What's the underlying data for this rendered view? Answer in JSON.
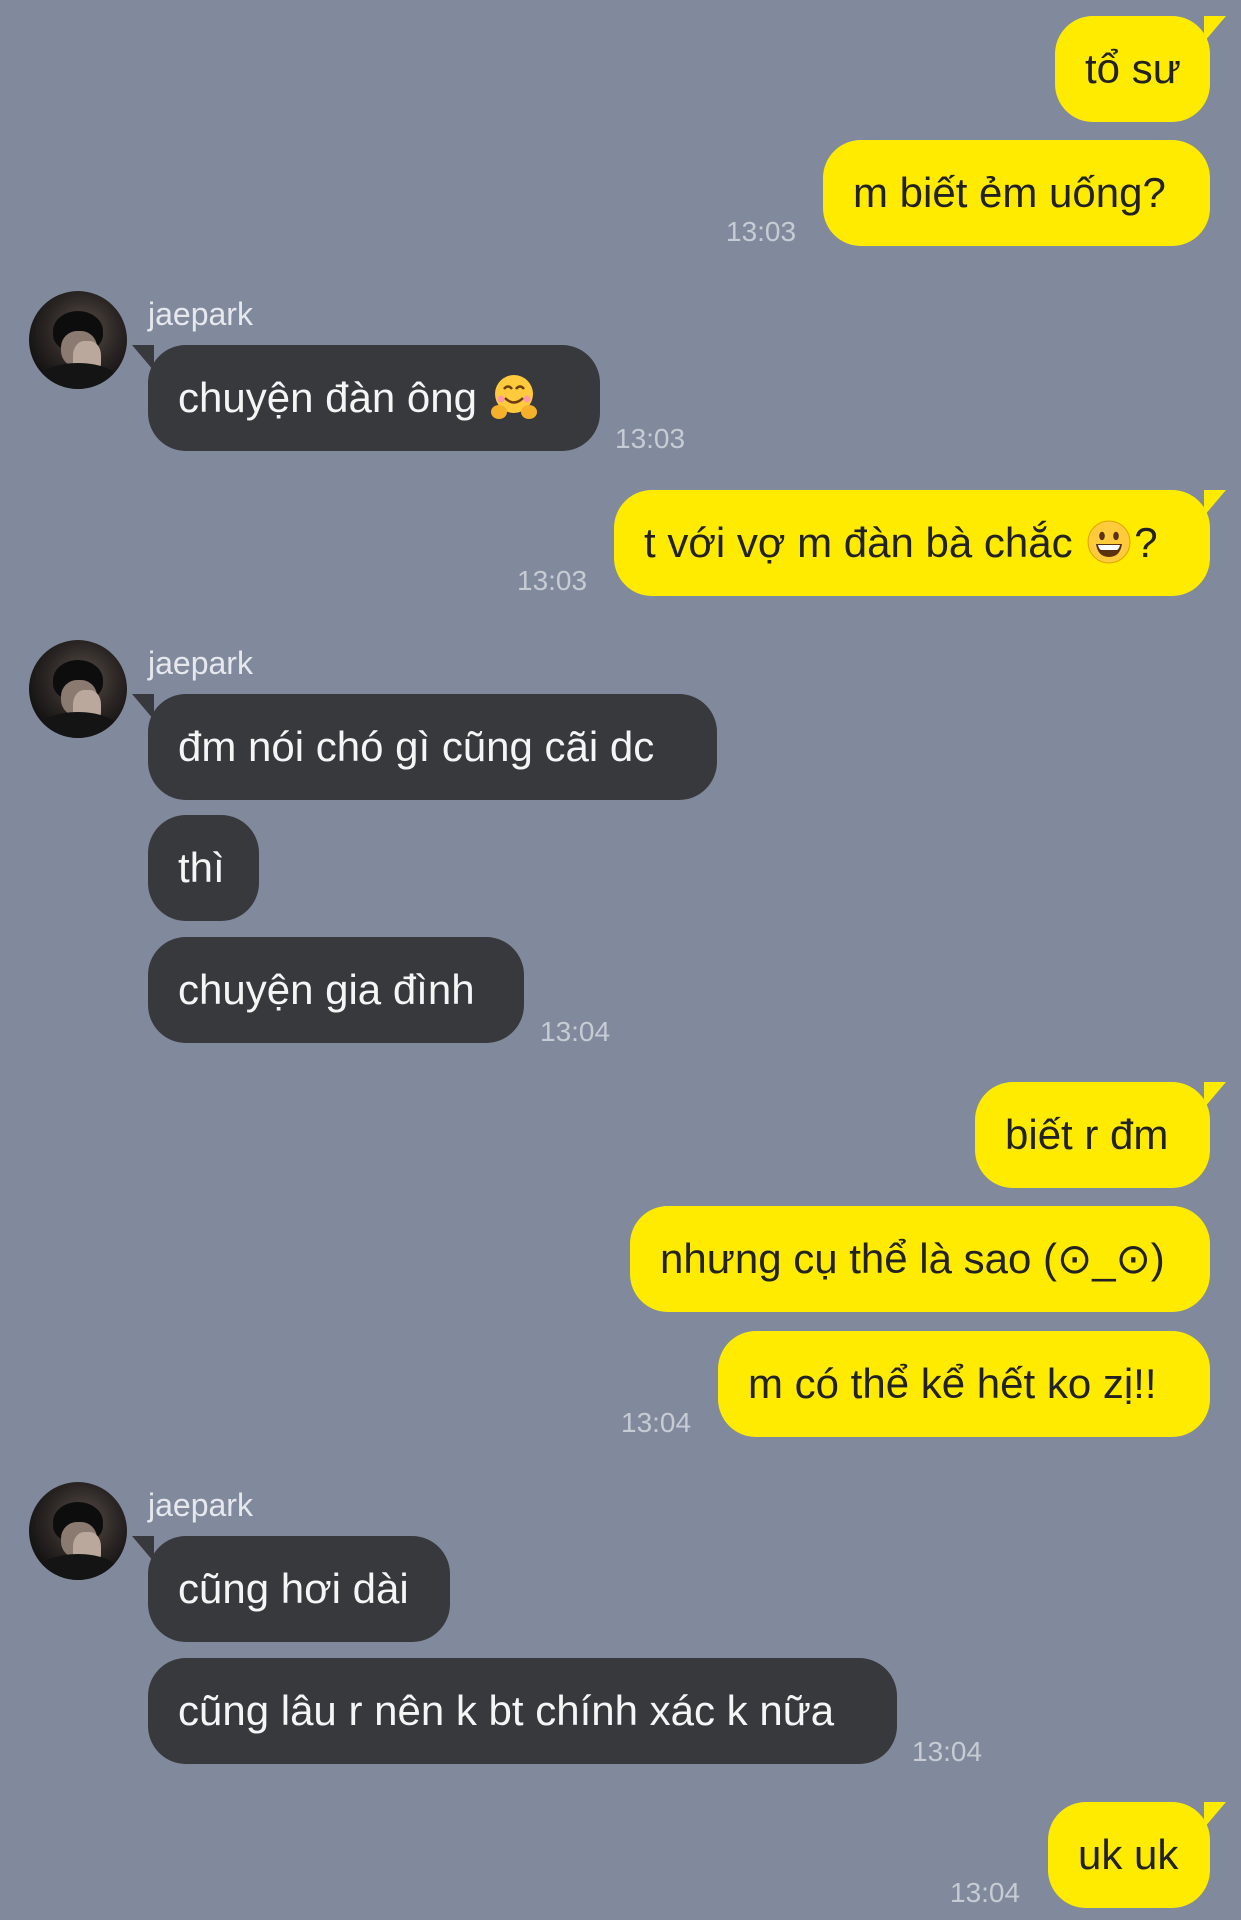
{
  "contact": {
    "name": "jaepark"
  },
  "messages": {
    "m1": "tổ sư",
    "m2": "m biết ẻm uống?",
    "m3": "chuyện đàn ông",
    "m4_before": "t với vợ m đàn bà chắc ",
    "m4_after": "?",
    "m5": "đm nói chó gì cũng cãi dc",
    "m6": "thì",
    "m7": "chuyện gia đình",
    "m8": "biết r đm",
    "m9": "nhưng cụ thể là sao (⊙_⊙)",
    "m10": "m có thể kể hết ko zị!!",
    "m11": "cũng hơi dài",
    "m12": "cũng lâu r nên k bt chính xác k nữa",
    "m13": "uk uk"
  },
  "emojis": {
    "hugging": "hugging-face-emoji",
    "grinning": "grinning-face-emoji"
  },
  "timestamps": {
    "t1": "13:03",
    "t2": "13:03",
    "t3": "13:03",
    "t4": "13:04",
    "t5": "13:04",
    "t6": "13:04",
    "t7": "13:04"
  },
  "colors": {
    "background": "#818a9c",
    "my_bubble": "#ffeb00",
    "their_bubble": "#38393c"
  }
}
